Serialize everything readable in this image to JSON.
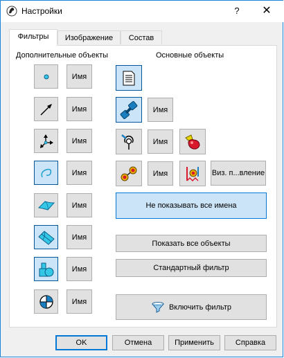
{
  "window": {
    "title": "Настройки",
    "help": "?",
    "close": "✕"
  },
  "tabs": [
    {
      "label": "Фильтры",
      "active": true
    },
    {
      "label": "Изображение",
      "active": false
    },
    {
      "label": "Состав",
      "active": false
    }
  ],
  "left": {
    "heading": "Дополнительные объекты",
    "rows": [
      {
        "icon": "point-icon",
        "name_label": "Имя",
        "pressed": false
      },
      {
        "icon": "vector-arrow-icon",
        "name_label": "Имя",
        "pressed": false
      },
      {
        "icon": "coordinate-axes-icon",
        "name_label": "Имя",
        "pressed": false
      },
      {
        "icon": "curve-icon",
        "name_label": "Имя",
        "pressed": true
      },
      {
        "icon": "surface-icon",
        "name_label": "Имя",
        "pressed": false
      },
      {
        "icon": "sheet-body-icon",
        "name_label": "Имя",
        "pressed": true
      },
      {
        "icon": "solid-body-icon",
        "name_label": "Имя",
        "pressed": true
      },
      {
        "icon": "center-of-mass-icon",
        "name_label": "Имя",
        "pressed": false
      }
    ]
  },
  "right": {
    "heading": "Основные объекты",
    "name_label": "Имя",
    "vis_label": "Виз. п...вление",
    "hide_names": "Не показывать все имена",
    "show_all": "Показать все объекты",
    "std_filter": "Стандартный фильтр",
    "enable_filter": "Включить фильтр"
  },
  "footer": {
    "ok": "OK",
    "cancel": "Отмена",
    "apply": "Применить",
    "help": "Справка"
  },
  "colors": {
    "accent": "#0078d7",
    "pressed_bg": "#cce4f7",
    "title_border": "#1883d7"
  }
}
